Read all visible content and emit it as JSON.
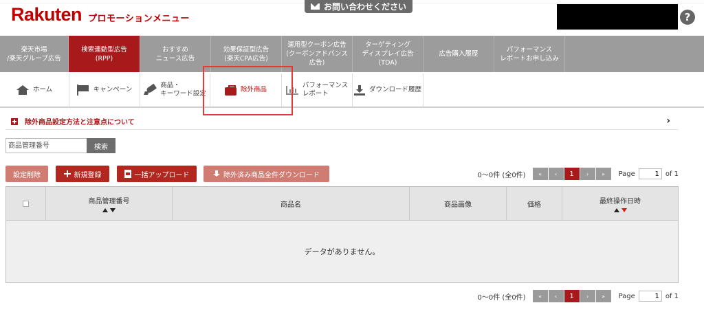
{
  "header": {
    "logo": "Rakuten",
    "subtitle": "プロモーションメニュー",
    "contact_label": "お問い合わせください",
    "help_icon": "question-circle-icon"
  },
  "main_nav": [
    {
      "label": "楽天市場\n/楽天グループ広告"
    },
    {
      "label": "検索連動型広告\n(RPP)"
    },
    {
      "label": "おすすめ\nニュース広告"
    },
    {
      "label": "効果保証型広告\n(楽天CPA広告)"
    },
    {
      "label": "運用型クーポン広告\n(クーポンアドバンス\n広告)"
    },
    {
      "label": "ターゲティング\nディスプレイ広告\n(TDA)"
    },
    {
      "label": "広告購入履歴"
    },
    {
      "label": "パフォーマンス\nレポートお申し込み"
    }
  ],
  "sub_nav": [
    {
      "label": "ホーム",
      "icon": "home-icon"
    },
    {
      "label": "キャンペーン",
      "icon": "flag-icon"
    },
    {
      "label": "商品・\nキーワード設定",
      "icon": "rocket-icon"
    },
    {
      "label": "除外商品",
      "icon": "briefcase-icon"
    },
    {
      "label": "パフォーマンス\nレポート",
      "icon": "bar-chart-icon"
    },
    {
      "label": "ダウンロード履歴",
      "icon": "download-icon"
    }
  ],
  "info": {
    "text": "除外商品設定方法と注意点について"
  },
  "search": {
    "placeholder": "商品管理番号",
    "button": "検索"
  },
  "actions": {
    "delete": "設定削除",
    "new": "新規登録",
    "upload": "一括アップロード",
    "download_all": "除外済み商品全件ダウンロード"
  },
  "pager": {
    "count_text": "0〜0件 (全0件)",
    "first": "«",
    "prev": "‹",
    "current": "1",
    "next": "›",
    "last": "»",
    "page_label": "Page",
    "page_value": "1",
    "of_text": "of 1"
  },
  "table": {
    "columns": [
      "商品管理番号",
      "商品名",
      "商品画像",
      "価格",
      "最終操作日時"
    ],
    "empty_message": "データがありません。"
  },
  "colors": {
    "brand": "#bf0000",
    "active_tab": "#a8191b",
    "nav_bg": "#9c9c9c",
    "button_dark": "#b2271f",
    "button_light": "#d07c72",
    "highlight": "#e53935"
  }
}
